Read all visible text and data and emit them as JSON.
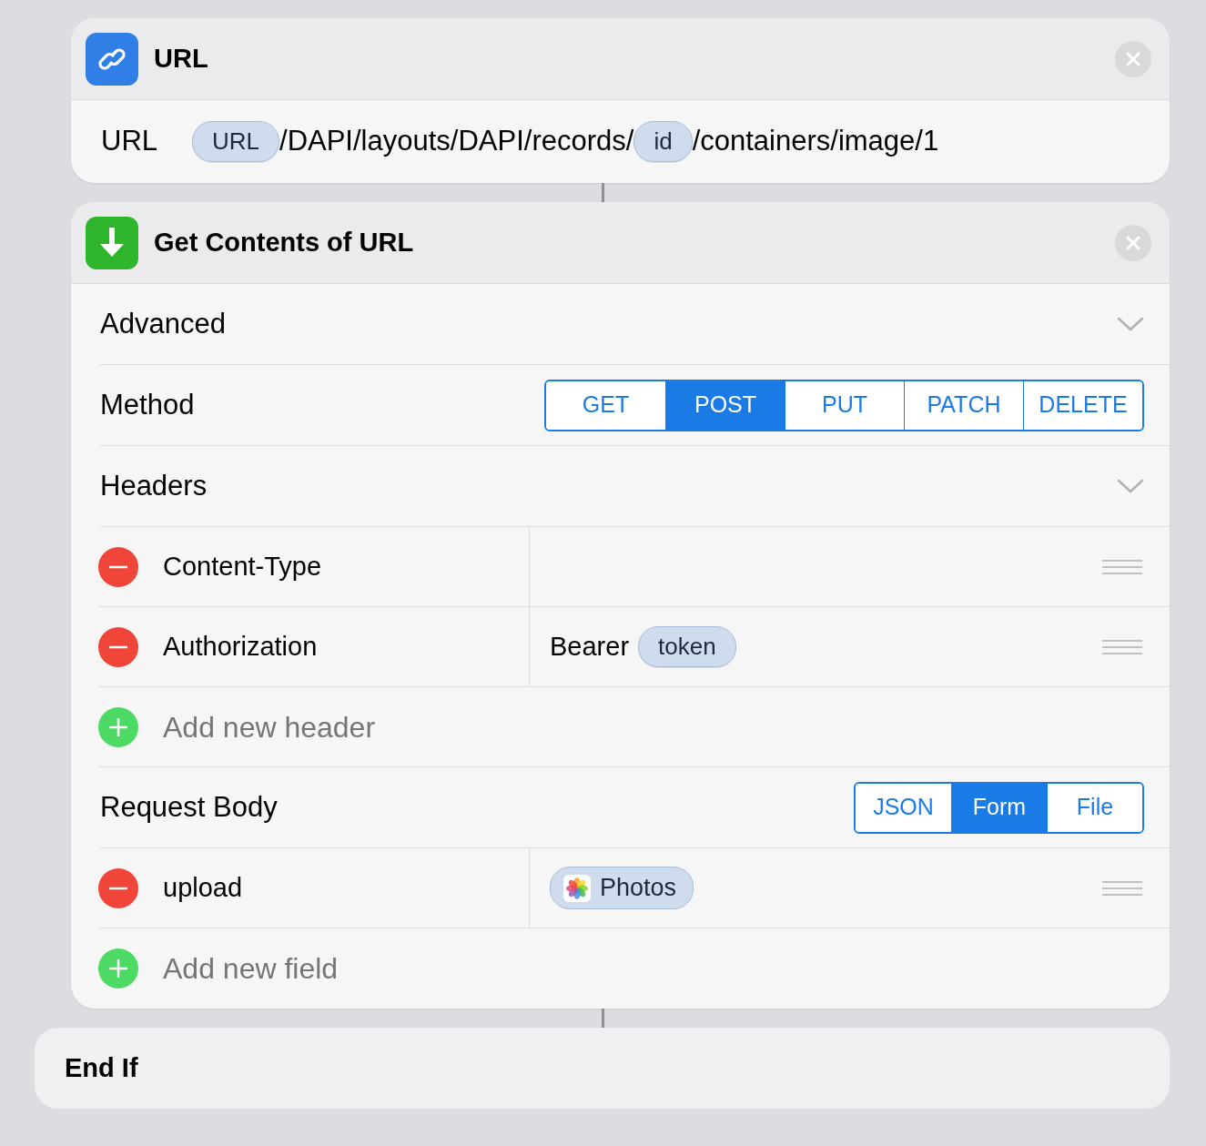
{
  "url_action": {
    "title": "URL",
    "field_label": "URL",
    "parts": [
      {
        "kind": "token",
        "text": "URL"
      },
      {
        "kind": "text",
        "text": "/DAPI/layouts/DAPI/records/"
      },
      {
        "kind": "token",
        "text": "id"
      },
      {
        "kind": "text",
        "text": "/containers/image/1"
      }
    ]
  },
  "get_contents_action": {
    "title": "Get Contents of URL",
    "advanced": {
      "label": "Advanced"
    },
    "method": {
      "label": "Method",
      "options": [
        {
          "label": "GET",
          "selected": false
        },
        {
          "label": "POST",
          "selected": true
        },
        {
          "label": "PUT",
          "selected": false
        },
        {
          "label": "PATCH",
          "selected": false
        },
        {
          "label": "DELETE",
          "selected": false
        }
      ]
    },
    "headers": {
      "label": "Headers",
      "rows": [
        {
          "key": "Content-Type"
        },
        {
          "key": "Authorization",
          "value_parts": [
            {
              "kind": "text",
              "text": "Bearer"
            },
            {
              "kind": "token",
              "text": "token"
            }
          ]
        }
      ],
      "add_placeholder": "Add new header"
    },
    "request_body": {
      "label": "Request Body",
      "options": [
        {
          "label": "JSON",
          "selected": false
        },
        {
          "label": "Form",
          "selected": true
        },
        {
          "label": "File",
          "selected": false
        }
      ],
      "rows": [
        {
          "key": "upload",
          "value_parts": [
            {
              "kind": "app_token",
              "text": "Photos"
            }
          ]
        }
      ],
      "add_placeholder": "Add new field"
    }
  },
  "end_if": {
    "title": "End If"
  }
}
